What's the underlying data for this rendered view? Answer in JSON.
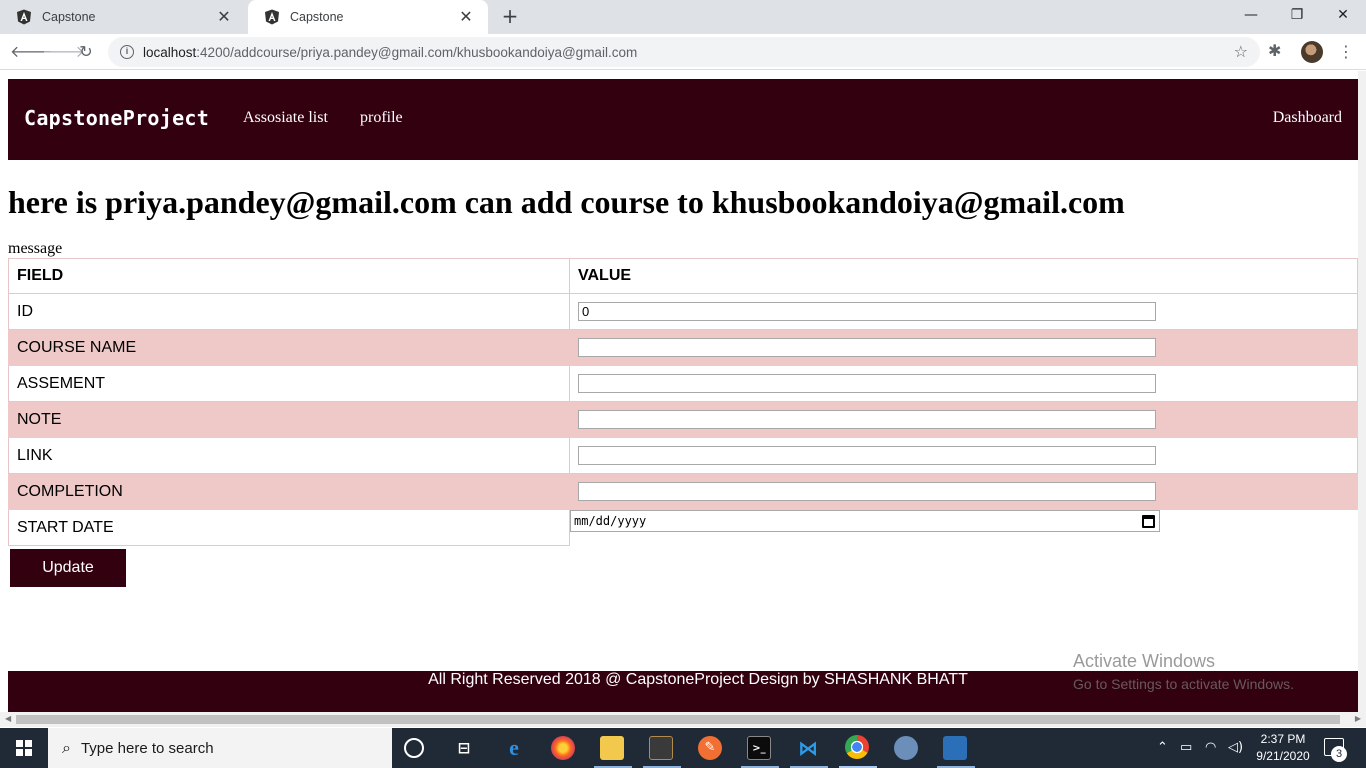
{
  "browser": {
    "tabs": [
      {
        "title": "Capstone",
        "active": false
      },
      {
        "title": "Capstone",
        "active": true
      }
    ],
    "url_host": "localhost",
    "url_path": ":4200/addcourse/priya.pandey@gmail.com/khusbookandoiya@gmail.com",
    "icons": {
      "back": "arrow-left",
      "forward": "arrow-right",
      "reload": "reload",
      "info": "info",
      "bookmark": "star",
      "extensions": "puzzle",
      "menu": "kebab"
    }
  },
  "navbar": {
    "brand": "CapstoneProject",
    "links": [
      "Assosiate list",
      "profile"
    ],
    "right_link": "Dashboard",
    "color": "#330010"
  },
  "page": {
    "heading": "here is priya.pandey@gmail.com can add course to khusbookandoiya@gmail.com",
    "message": "message"
  },
  "table": {
    "headers": {
      "field": "FIELD",
      "value": "VALUE"
    },
    "rows": [
      {
        "label": "ID",
        "value": "0"
      },
      {
        "label": "COURSE NAME",
        "value": ""
      },
      {
        "label": "ASSEMENT",
        "value": ""
      },
      {
        "label": "NOTE",
        "value": ""
      },
      {
        "label": "LINK",
        "value": ""
      },
      {
        "label": "COMPLETION",
        "value": ""
      }
    ],
    "start_date": {
      "label": "START DATE",
      "placeholder": "mm/dd/yyyy"
    },
    "stripe_color": "#efc8c8"
  },
  "actions": {
    "update_label": "Update"
  },
  "footer": {
    "text": "All Right Reserved 2018 @ CapstoneProject Design by SHASHANK BHATT"
  },
  "watermark": {
    "title": "Activate Windows",
    "subtitle": "Go to Settings to activate Windows."
  },
  "taskbar": {
    "search_placeholder": "Type here to search",
    "time": "2:37 PM",
    "date": "9/21/2020",
    "notifications": "3"
  }
}
